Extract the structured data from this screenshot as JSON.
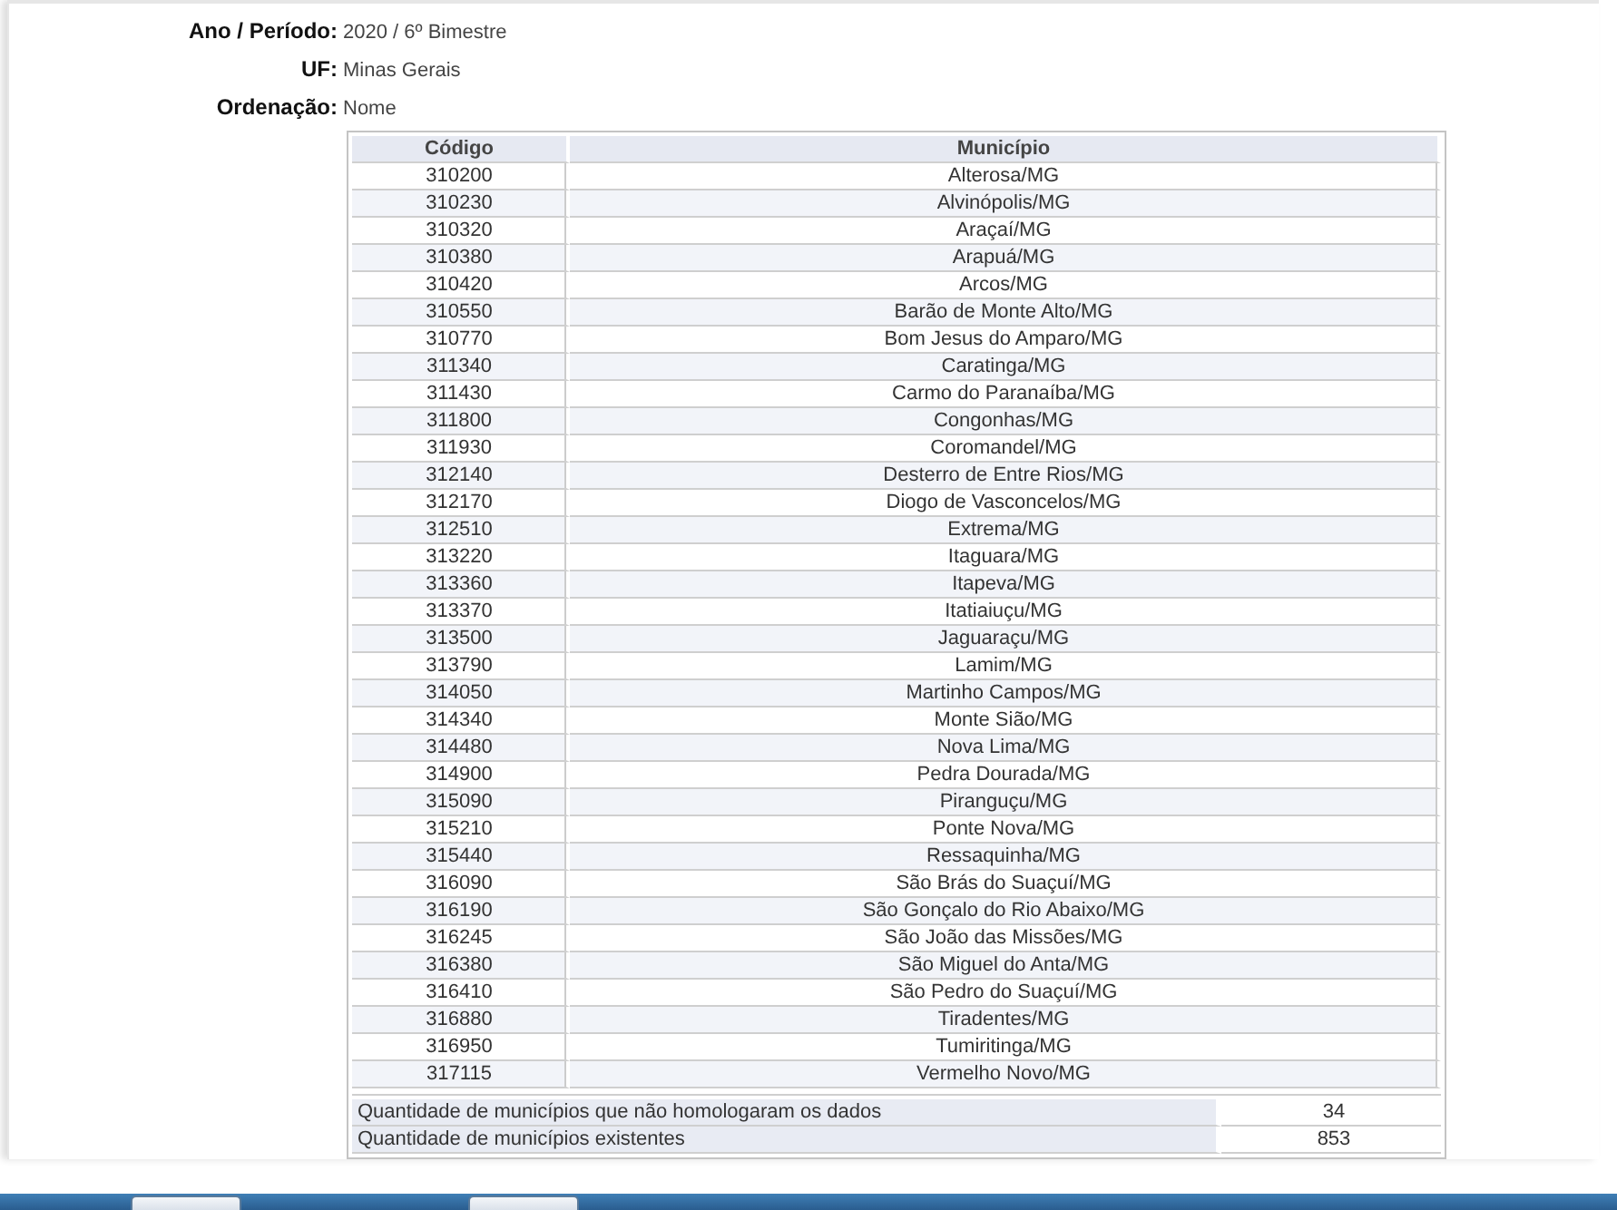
{
  "info": [
    {
      "label": "Ano / Período:",
      "value": "2020 / 6º Bimestre"
    },
    {
      "label": "UF:",
      "value": "Minas Gerais"
    },
    {
      "label": "Ordenação:",
      "value": "Nome"
    }
  ],
  "table": {
    "columns": [
      "Código",
      "Município"
    ],
    "rows": [
      [
        "310200",
        "Alterosa/MG"
      ],
      [
        "310230",
        "Alvinópolis/MG"
      ],
      [
        "310320",
        "Araçaí/MG"
      ],
      [
        "310380",
        "Arapuá/MG"
      ],
      [
        "310420",
        "Arcos/MG"
      ],
      [
        "310550",
        "Barão de Monte Alto/MG"
      ],
      [
        "310770",
        "Bom Jesus do Amparo/MG"
      ],
      [
        "311340",
        "Caratinga/MG"
      ],
      [
        "311430",
        "Carmo do Paranaíba/MG"
      ],
      [
        "311800",
        "Congonhas/MG"
      ],
      [
        "311930",
        "Coromandel/MG"
      ],
      [
        "312140",
        "Desterro de Entre Rios/MG"
      ],
      [
        "312170",
        "Diogo de Vasconcelos/MG"
      ],
      [
        "312510",
        "Extrema/MG"
      ],
      [
        "313220",
        "Itaguara/MG"
      ],
      [
        "313360",
        "Itapeva/MG"
      ],
      [
        "313370",
        "Itatiaiuçu/MG"
      ],
      [
        "313500",
        "Jaguaraçu/MG"
      ],
      [
        "313790",
        "Lamim/MG"
      ],
      [
        "314050",
        "Martinho Campos/MG"
      ],
      [
        "314340",
        "Monte Sião/MG"
      ],
      [
        "314480",
        "Nova Lima/MG"
      ],
      [
        "314900",
        "Pedra Dourada/MG"
      ],
      [
        "315090",
        "Piranguçu/MG"
      ],
      [
        "315210",
        "Ponte Nova/MG"
      ],
      [
        "315440",
        "Ressaquinha/MG"
      ],
      [
        "316090",
        "São Brás do Suaçuí/MG"
      ],
      [
        "316190",
        "São Gonçalo do Rio Abaixo/MG"
      ],
      [
        "316245",
        "São João das Missões/MG"
      ],
      [
        "316380",
        "São Miguel do Anta/MG"
      ],
      [
        "316410",
        "São Pedro do Suaçuí/MG"
      ],
      [
        "316880",
        "Tiradentes/MG"
      ],
      [
        "316950",
        "Tumiritinga/MG"
      ],
      [
        "317115",
        "Vermelho Novo/MG"
      ]
    ]
  },
  "summary": [
    {
      "label": "Quantidade de municípios que não homologaram os dados",
      "value": "34"
    },
    {
      "label": "Quantidade de municípios existentes",
      "value": "853"
    }
  ]
}
